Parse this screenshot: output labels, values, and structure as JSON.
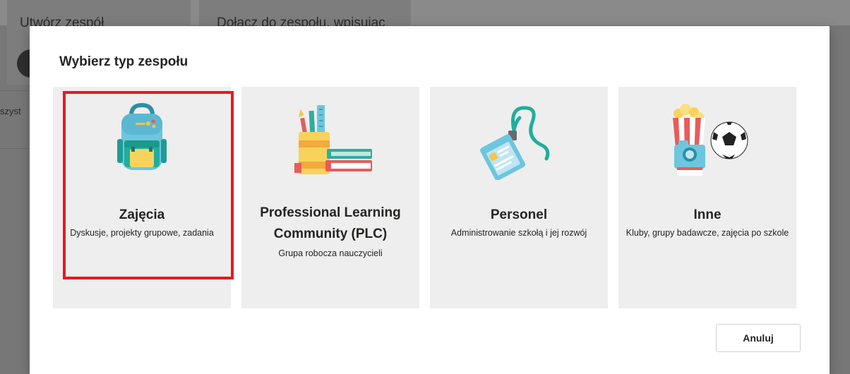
{
  "background": {
    "create_team_label": "Utwórz zespół",
    "join_team_label": "Dołącz do zespołu, wpisując",
    "sidebar_partial": "szyst"
  },
  "dialog": {
    "title": "Wybierz typ zespołu",
    "cards": [
      {
        "title": "Zajęcia",
        "description": "Dyskusje, projekty grupowe, zadania",
        "icon": "backpack-icon"
      },
      {
        "title": "Professional Learning Community (PLC)",
        "description": "Grupa robocza nauczycieli",
        "icon": "school-supplies-icon"
      },
      {
        "title": "Personel",
        "description": "Administrowanie szkołą i jej rozwój",
        "icon": "lanyard-badge-icon"
      },
      {
        "title": "Inne",
        "description": "Kluby, grupy badawcze, zajęcia po szkole",
        "icon": "popcorn-ball-camera-icon"
      }
    ],
    "cancel_label": "Anuluj"
  },
  "colors": {
    "highlight": "#e8191f",
    "card_background": "#eeeeee",
    "overlay": "#777777"
  }
}
